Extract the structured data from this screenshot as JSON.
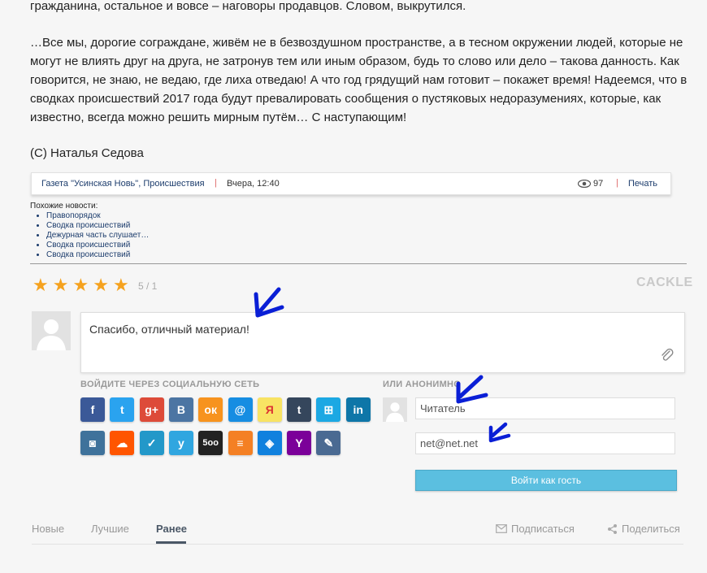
{
  "article": {
    "p1": "гражданина, остальное и вовсе – наговоры продавцов. Словом, выкрутился.",
    "p2": "…Все мы, дорогие сограждане, живём не в безвоздушном пространстве, а в тесном окружении людей, которые не могут не влиять друг на друга, не затронув тем или иным образом, будь то слово или дело – такова данность. Как говорится, не знаю, не ведаю, где лиха отведаю! А что год грядущий нам готовит – покажет время! Надеемся, что в сводках происшествий 2017 года будут превалировать сообщения о пустяковых недоразумениях, которые, как известно, всегда можно решить мирным путём… С наступающим!",
    "signature": "(С) Наталья Седова"
  },
  "infobar": {
    "source": "Газета \"Усинская Новь\"",
    "comma": ",",
    "category": "Происшествия",
    "sep": "|",
    "date": "Вчера, 12:40",
    "views": "97",
    "print": "Печать"
  },
  "similar": {
    "title": "Похожие новости:",
    "items": [
      "Правопорядок",
      "Сводка происшествий",
      "Дежурная часть слушает…",
      "Сводка происшествий",
      "Сводка происшествий"
    ]
  },
  "rating": {
    "value": 5,
    "max": 5,
    "label": "5 / 1"
  },
  "brand": "CACKLE",
  "comment": {
    "text": "Спасибо, отличный материал!"
  },
  "social_label": "ВОЙДИТЕ ЧЕРЕЗ СОЦИАЛЬНУЮ СЕТЬ",
  "anon_label": "ИЛИ АНОНИМНО",
  "social_icons": [
    {
      "name": "facebook",
      "glyph": "f",
      "color": "#3b5998"
    },
    {
      "name": "twitter",
      "glyph": "t",
      "color": "#2aa3ef"
    },
    {
      "name": "google-plus",
      "glyph": "g+",
      "color": "#dd4b39"
    },
    {
      "name": "vk",
      "glyph": "B",
      "color": "#4c75a3"
    },
    {
      "name": "odnoklassniki",
      "glyph": "ок",
      "color": "#f7931e"
    },
    {
      "name": "mailru",
      "glyph": "@",
      "color": "#168de2"
    },
    {
      "name": "yandex",
      "glyph": "Я",
      "color": "#f8e363"
    },
    {
      "name": "tumblr",
      "glyph": "t",
      "color": "#35465c"
    },
    {
      "name": "windows",
      "glyph": "⊞",
      "color": "#1ca8e3"
    },
    {
      "name": "linkedin",
      "glyph": "in",
      "color": "#0e76a8"
    },
    {
      "name": "instagram",
      "glyph": "◙",
      "color": "#3f729b"
    },
    {
      "name": "soundcloud",
      "glyph": "☁",
      "color": "#ff5500"
    },
    {
      "name": "foursquare",
      "glyph": "✓",
      "color": "#2398c9"
    },
    {
      "name": "yahoo-answers",
      "glyph": "у",
      "color": "#30a6e0"
    },
    {
      "name": "500px",
      "glyph": "5oo",
      "color": "#222222"
    },
    {
      "name": "stackoverflow",
      "glyph": "≡",
      "color": "#f48024"
    },
    {
      "name": "dropbox",
      "glyph": "◈",
      "color": "#1081de"
    },
    {
      "name": "yahoo",
      "glyph": "Y",
      "color": "#7b0099"
    },
    {
      "name": "livejournal",
      "glyph": "✎",
      "color": "#4a6a92"
    }
  ],
  "guest": {
    "name_value": "Читатель",
    "email_value": "net@net.net",
    "button": "Войти как гость"
  },
  "tabs": [
    {
      "label": "Новые",
      "active": false
    },
    {
      "label": "Лучшие",
      "active": false
    },
    {
      "label": "Ранее",
      "active": true
    }
  ],
  "actions": {
    "subscribe": "Подписаться",
    "share": "Поделиться"
  },
  "colors": {
    "accent_button": "#5bbfe0",
    "star": "#f5a21f",
    "annotation_arrow": "#0a1fd6"
  }
}
